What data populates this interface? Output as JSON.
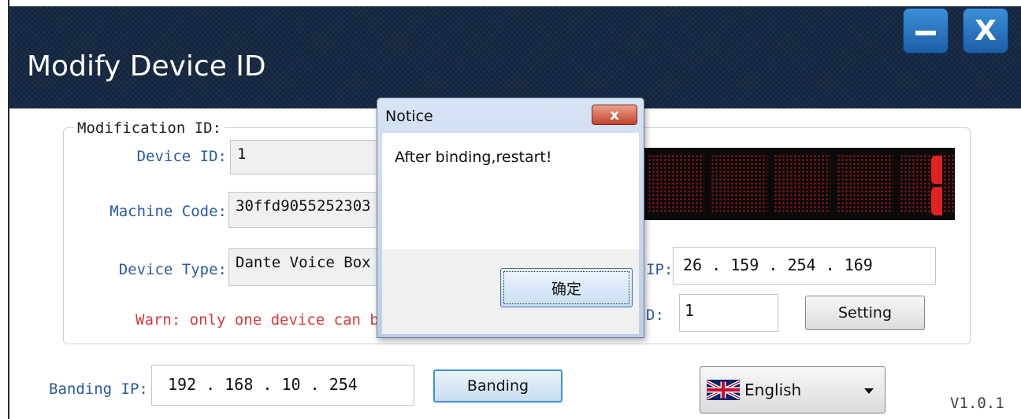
{
  "window": {
    "title": "Modify Device ID",
    "minimize_icon": "minimize-icon",
    "close_glyph": "X"
  },
  "modification": {
    "group_title": "Modification ID:",
    "device_id_label": "Device ID:",
    "device_id_value": "1",
    "machine_code_label": "Machine Code:",
    "machine_code_value": "30ffd9055252303",
    "device_type_label": "Device Type:",
    "device_type_value": "Dante Voice Box",
    "warning": "Warn: only one device can be"
  },
  "target": {
    "ip_label": "IP:",
    "ip_value": "26  . 159  . 254  . 169",
    "id_label": "D:",
    "id_value": "1",
    "setting_button": "Setting"
  },
  "binding": {
    "label": "Banding IP:",
    "ip_value": "192  . 168  .  10  . 254",
    "button": "Banding"
  },
  "language": {
    "selected": "English",
    "flag_icon": "uk-flag-icon"
  },
  "version": "V1.0.1",
  "dialog": {
    "title": "Notice",
    "close_glyph": "x",
    "message": "After binding,restart!",
    "ok_button": "确定"
  },
  "colors": {
    "titlebar": "#14263f",
    "label_blue": "#2a5aa0",
    "warning_red": "#d43b3b",
    "led_on": "#e02222"
  }
}
